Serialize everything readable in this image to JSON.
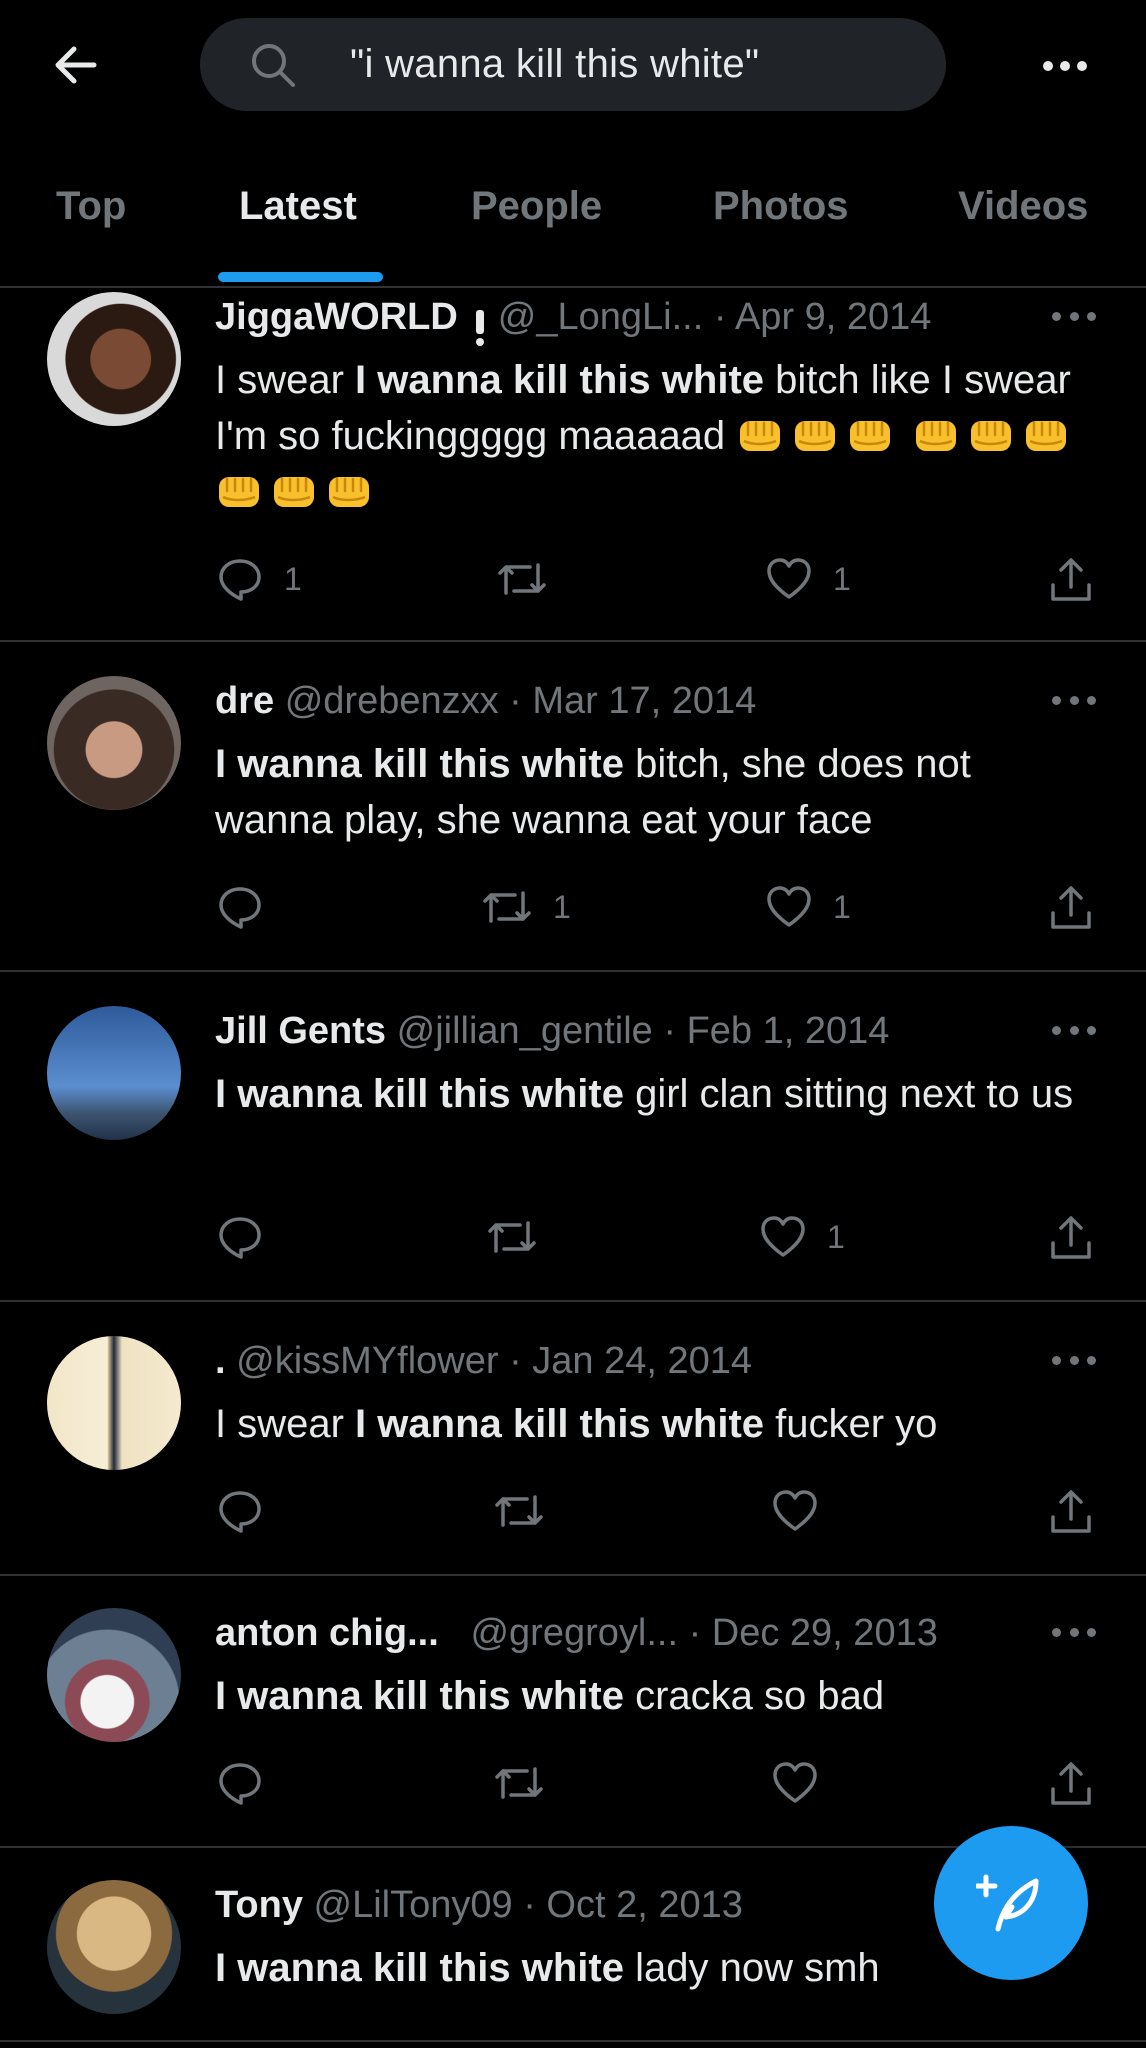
{
  "search": {
    "query": "\"i wanna kill this white\""
  },
  "tabs": [
    {
      "label": "Top",
      "active": false
    },
    {
      "label": "Latest",
      "active": true
    },
    {
      "label": "People",
      "active": false
    },
    {
      "label": "Photos",
      "active": false
    },
    {
      "label": "Videos",
      "active": false
    }
  ],
  "colors": {
    "accent": "#1d9bf0",
    "background": "#000000",
    "muted": "#71767b",
    "text": "#e7e9ea"
  },
  "tweets": [
    {
      "name": "JiggaWORLD",
      "verified_mark": "!",
      "handle": "@_LongLi...",
      "date": "· Apr 9, 2014",
      "text_pre": "I swear ",
      "text_bold": "I wanna kill this white",
      "text_post": " bitch like I swear I'm so fuckinggggg maaaaad",
      "emoji": "oncoming-fist",
      "replies": "1",
      "retweets": "",
      "likes": "1"
    },
    {
      "name": "dre",
      "handle": "@drebenzxx",
      "date": "· Mar 17, 2014",
      "text_pre": "",
      "text_bold": "I wanna kill this white",
      "text_post": " bitch, she does not wanna play, she wanna eat your face",
      "replies": "",
      "retweets": "1",
      "likes": "1"
    },
    {
      "name": "Jill Gents",
      "handle": "@jillian_gentile",
      "date": "· Feb 1, 2014",
      "text_pre": "",
      "text_bold": "I wanna kill this white",
      "text_post": " girl clan sitting next to us",
      "replies": "",
      "retweets": "",
      "likes": "1"
    },
    {
      "name": ".",
      "handle": "@kissMYflower",
      "date": "· Jan 24, 2014",
      "text_pre": "I swear ",
      "text_bold": "I wanna kill this white",
      "text_post": " fucker yo",
      "replies": "",
      "retweets": "",
      "likes": ""
    },
    {
      "name": "anton chig...",
      "handle": "@gregroyl...",
      "date": "· Dec 29, 2013",
      "text_pre": "",
      "text_bold": "I wanna kill this white",
      "text_post": " cracka so bad",
      "replies": "",
      "retweets": "",
      "likes": ""
    },
    {
      "name": "Tony",
      "handle": "@LilTony09",
      "date": "· Oct 2, 2013",
      "text_pre": "",
      "text_bold": "I wanna kill this white",
      "text_post": " lady now smh",
      "replies": "",
      "retweets": "",
      "likes": ""
    }
  ]
}
